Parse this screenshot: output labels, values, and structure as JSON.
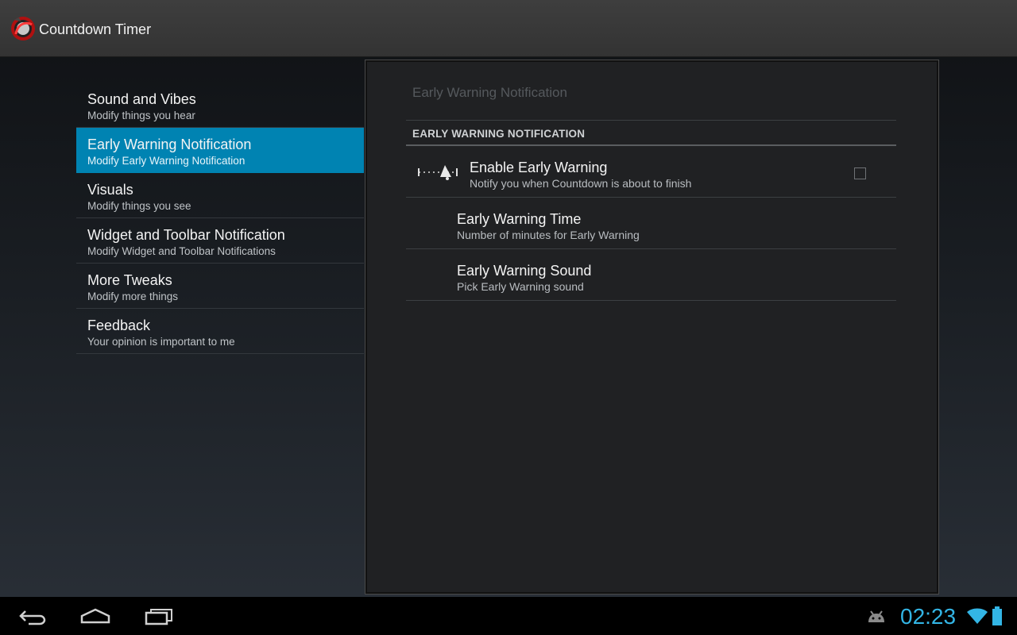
{
  "action_bar": {
    "title": "Countdown Timer",
    "app_icon": "countdown-timer-app-icon"
  },
  "headers": [
    {
      "title": "Sound and Vibes",
      "summary": "Modify things you hear",
      "selected": false
    },
    {
      "title": "Early Warning Notification",
      "summary": "Modify Early Warning Notification",
      "selected": true
    },
    {
      "title": "Visuals",
      "summary": "Modify things you see",
      "selected": false
    },
    {
      "title": "Widget and Toolbar Notification",
      "summary": "Modify Widget and Toolbar Notifications",
      "selected": false
    },
    {
      "title": "More Tweaks",
      "summary": "Modify more things",
      "selected": false
    },
    {
      "title": "Feedback",
      "summary": "Your opinion is important to me",
      "selected": false
    }
  ],
  "panel": {
    "title": "Early Warning Notification",
    "category": "EARLY WARNING NOTIFICATION",
    "prefs": [
      {
        "title": "Enable Early Warning",
        "summary": "Notify you when Countdown is about to finish",
        "icon": "bell-timeline-icon",
        "checked": false
      },
      {
        "title": "Early Warning Time",
        "summary": "Number of minutes for Early Warning"
      },
      {
        "title": "Early Warning Sound",
        "summary": "Pick Early Warning sound"
      }
    ]
  },
  "system_bar": {
    "clock": "02:23",
    "icons": [
      "back-icon",
      "home-icon",
      "recent-apps-icon",
      "android-notification-icon",
      "wifi-icon",
      "battery-icon"
    ]
  },
  "colors": {
    "accent": "#0083b2",
    "clock": "#33b5e5"
  }
}
